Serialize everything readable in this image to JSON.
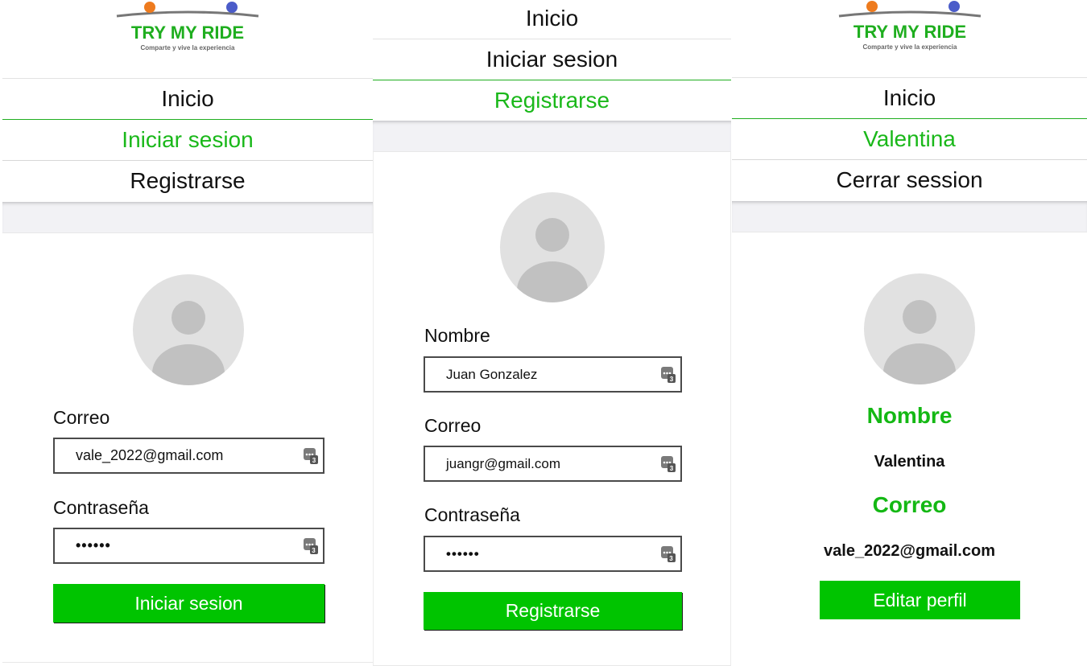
{
  "brand": {
    "name": "TRY MY RIDE",
    "tagline": "Comparte y vive la experiencia"
  },
  "screen1": {
    "nav": [
      "Inicio",
      "Iniciar sesion",
      "Registrarse"
    ],
    "active_index": 1,
    "correo_label": "Correo",
    "correo_value": "vale_2022@gmail.com",
    "password_label": "Contraseña",
    "password_value": "••••••",
    "button": "Iniciar sesion"
  },
  "screen2": {
    "nav": [
      "Inicio",
      "Iniciar sesion",
      "Registrarse"
    ],
    "active_index": 2,
    "nombre_label": "Nombre",
    "nombre_value": "Juan Gonzalez",
    "correo_label": "Correo",
    "correo_value": "juangr@gmail.com",
    "password_label": "Contraseña",
    "password_value": "••••••",
    "button": "Registrarse"
  },
  "screen3": {
    "nav": [
      "Inicio",
      "Valentina",
      "Cerrar session"
    ],
    "active_index": 1,
    "nombre_heading": "Nombre",
    "nombre_value": "Valentina",
    "correo_heading": "Correo",
    "correo_value": "vale_2022@gmail.com",
    "button": "Editar perfil"
  },
  "colors": {
    "accent": "#00c400",
    "accent_text": "#14b814",
    "band": "#f2f2f5"
  }
}
